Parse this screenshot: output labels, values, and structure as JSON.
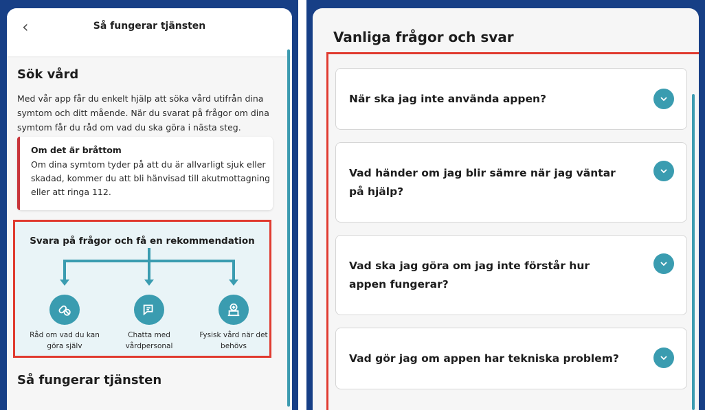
{
  "left": {
    "header": {
      "back_icon": "chevron-left-icon",
      "title": "Så fungerar tjänsten"
    },
    "search_care": {
      "heading": "Sök vård",
      "intro": "Med vår app får du enkelt hjälp att söka vård utifrån dina symtom och ditt mående. När du svarat på frågor om dina symtom får du råd om vad du ska göra i nästa steg."
    },
    "urgent_alert": {
      "title": "Om det är bråttom",
      "text": "Om dina symtom tyder på att du är allvarligt sjuk eller skadad, kommer du att bli hänvisad till akutmottagning eller att ringa 112.",
      "accent_color": "#c8343a"
    },
    "diagram": {
      "title": "Svara på frågor och få en rekommendation",
      "options": [
        {
          "icon": "pills-icon",
          "label_line1": "Råd om vad du kan",
          "label_line2": "göra själv"
        },
        {
          "icon": "chat-icon",
          "label_line1": "Chatta med",
          "label_line2": "vårdpersonal"
        },
        {
          "icon": "hospital-icon",
          "label_line1": "Fysisk vård när det",
          "label_line2": "behövs"
        }
      ],
      "accent_color": "#3a9cb0"
    },
    "next_heading": "Så fungerar tjänsten"
  },
  "right": {
    "faq_title": "Vanliga frågor och svar",
    "faq": [
      {
        "question": "När ska jag inte använda appen?"
      },
      {
        "question": "Vad händer om jag blir sämre när jag väntar på hjälp?"
      },
      {
        "question": "Vad ska jag göra om jag inte förstår hur appen fungerar?"
      },
      {
        "question": "Vad gör jag om appen har tekniska problem?"
      }
    ],
    "toggle_icon": "chevron-down-icon"
  },
  "colors": {
    "frame": "#173f86",
    "highlight": "#e03a2f",
    "teal": "#3a9cb0"
  }
}
